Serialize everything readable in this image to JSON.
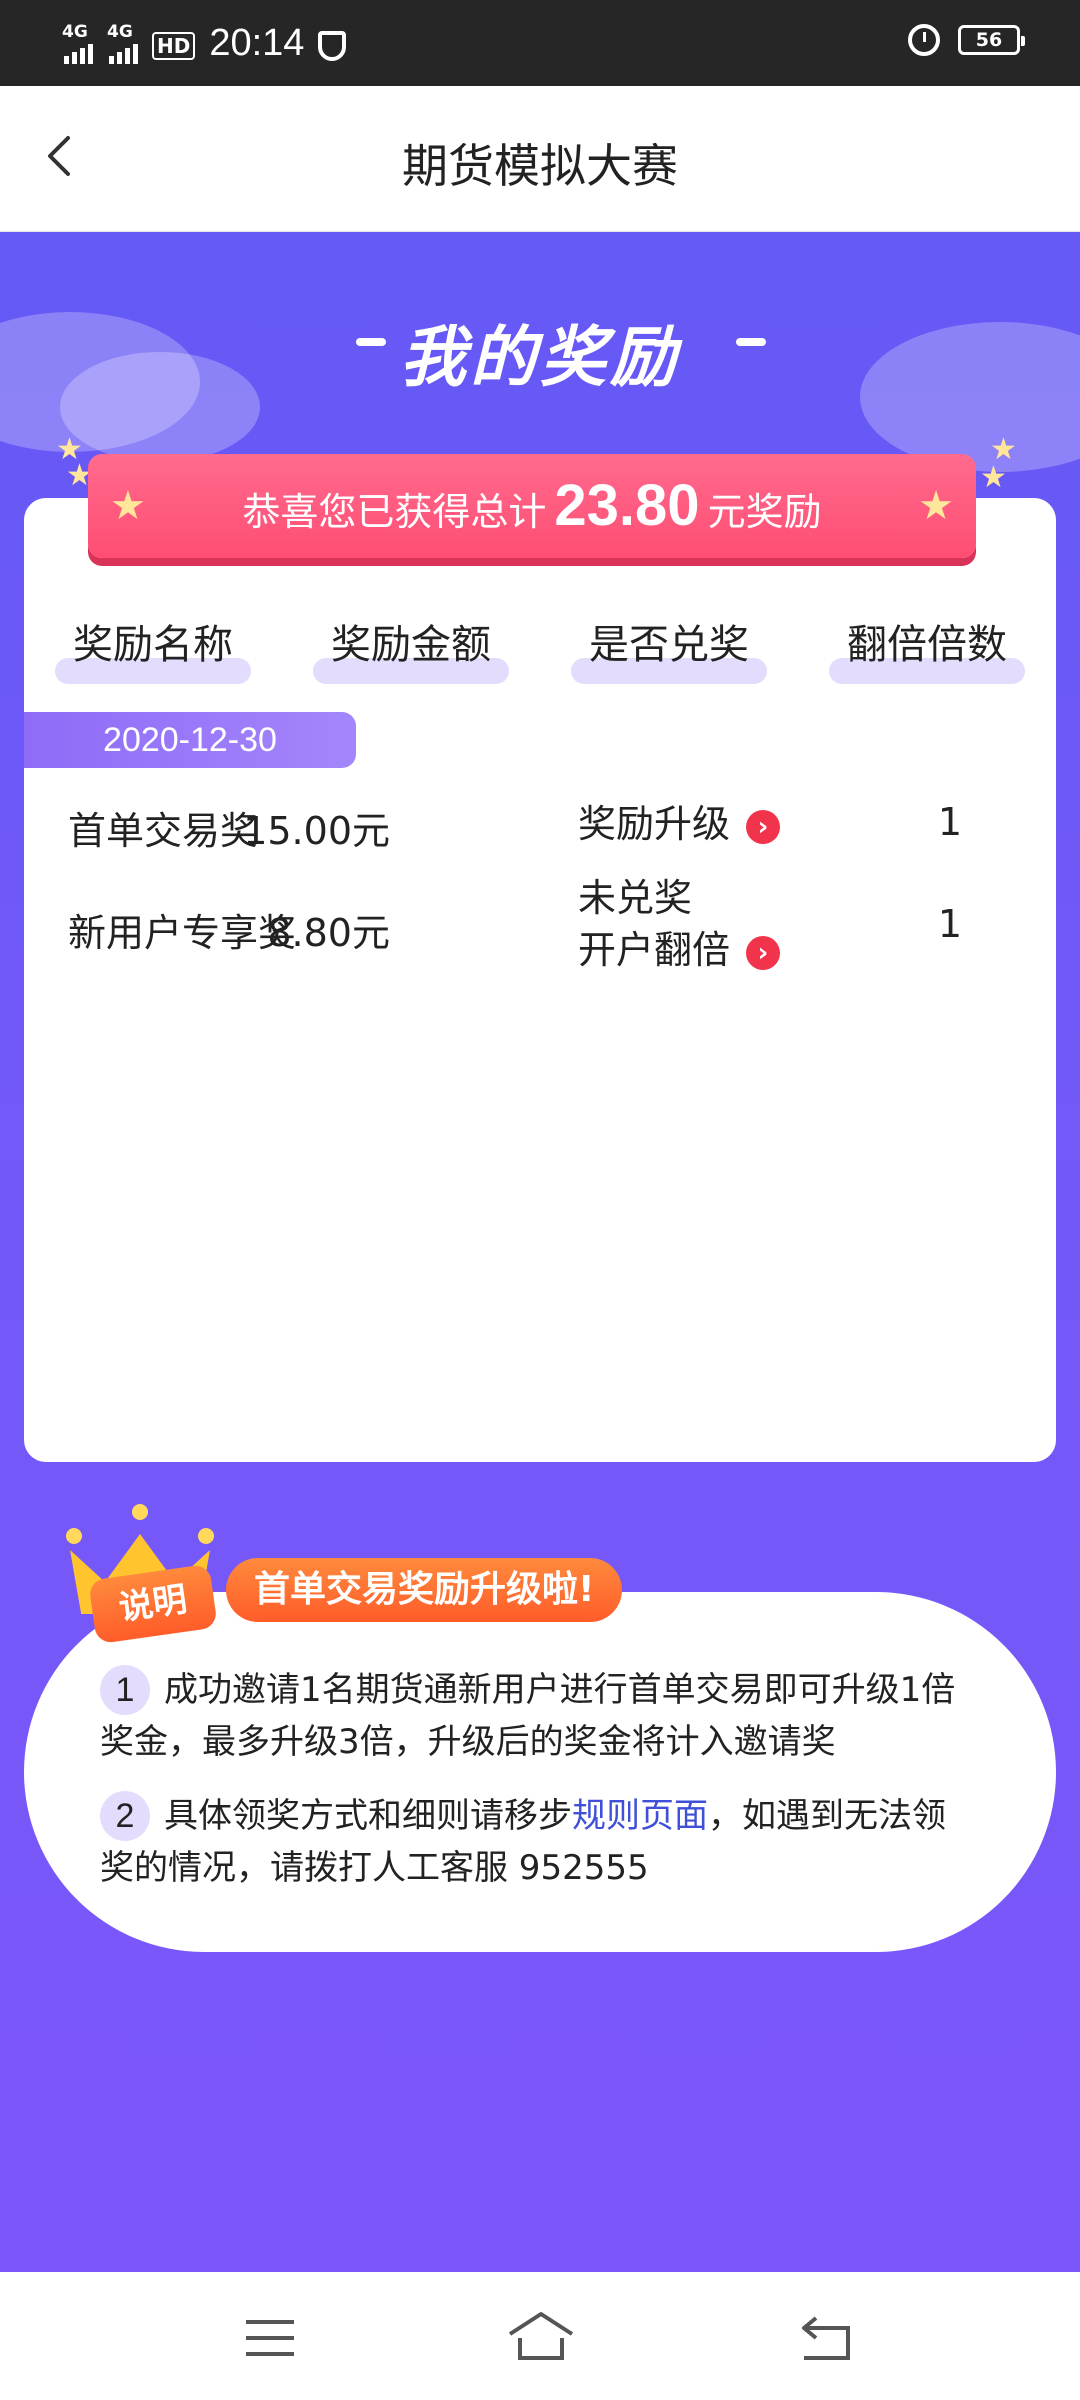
{
  "status_bar": {
    "network1": "4G",
    "network2": "4G",
    "hd": "HD",
    "time": "20:14",
    "battery": "56"
  },
  "header": {
    "title": "期货模拟大赛"
  },
  "section_title": "我的奖励",
  "banner": {
    "prefix": "恭喜您已获得总计",
    "amount": "23.80",
    "suffix": "元奖励"
  },
  "table": {
    "columns": [
      "奖励名称",
      "奖励金额",
      "是否兑奖",
      "翻倍倍数"
    ],
    "date": "2020-12-30",
    "rows": [
      {
        "name": "首单交易奖",
        "amount": "15.00元",
        "status": "奖励升级",
        "status2": "",
        "multiplier": "1"
      },
      {
        "name": "新用户专享奖",
        "amount": "8.80元",
        "status": "未兑奖",
        "status2": "开户翻倍",
        "multiplier": "1"
      }
    ]
  },
  "explanation": {
    "badge": "说明",
    "headline": "首单交易奖励升级啦!",
    "notes": [
      {
        "num": "1",
        "text": "成功邀请1名期货通新用户进行首单交易即可升级1倍奖金，最多升级3倍，升级后的奖金将计入邀请奖"
      },
      {
        "num": "2",
        "text_before": "具体领奖方式和细则请移步",
        "link": "规则页面",
        "text_after": "，如遇到无法领奖的情况，请拨打人工客服 952555"
      }
    ]
  },
  "colors": {
    "purple": "#6e59f7",
    "pink": "#ff5077",
    "orange": "#ff6a2f",
    "red_arrow": "#f1334c",
    "link": "#3f4fd8"
  }
}
